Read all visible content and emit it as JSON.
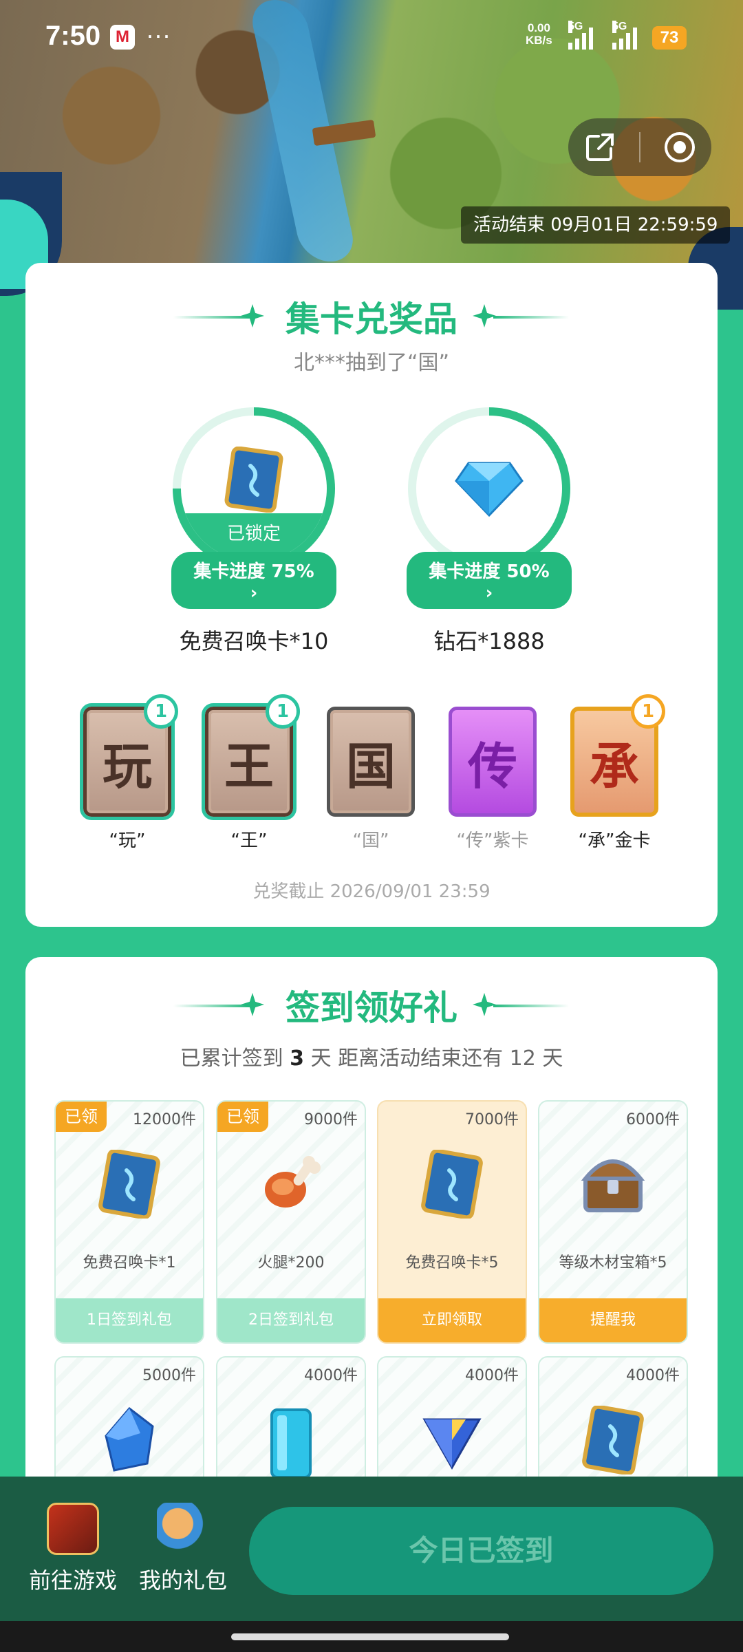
{
  "status_bar": {
    "time": "7:50",
    "carrier_badge": "M",
    "more": "···",
    "net_speed": "0.00",
    "net_unit": "KB/s",
    "signal1_label": "5G",
    "signal2_label": "5G",
    "battery": "73"
  },
  "hero": {
    "event_end": "活动结束 09月01日 22:59:59"
  },
  "card_collect": {
    "title": "集卡兑奖品",
    "subtitle": "北***抽到了“国”",
    "prizes": [
      {
        "name": "免费召唤卡*10",
        "progress": "集卡进度 75%",
        "progress_value": 0.75,
        "locked_text": "已锁定",
        "icon": "summon-card-icon"
      },
      {
        "name": "钻石*1888",
        "progress": "集卡进度 50%",
        "progress_value": 0.5,
        "icon": "diamond-icon"
      }
    ],
    "cards": [
      {
        "char": "玩",
        "label": "“玩”",
        "count": "1"
      },
      {
        "char": "王",
        "label": "“王”",
        "count": "1"
      },
      {
        "char": "国",
        "label": "“国”"
      },
      {
        "char": "传",
        "label": "“传”紫卡"
      },
      {
        "char": "承",
        "label": "“承”金卡",
        "count": "1"
      }
    ],
    "deadline": "兑奖截止 2026/09/01 23:59"
  },
  "checkin": {
    "title": "签到领好礼",
    "summary_prefix": "已累计签到 ",
    "days": "3",
    "summary_suffix": " 天  距离活动结束还有 12 天",
    "gifts": [
      {
        "qty": "12000件",
        "claimed": "已领",
        "name": "免费召唤卡*1",
        "button": "1日签到礼包",
        "icon": "summon-card-icon"
      },
      {
        "qty": "9000件",
        "claimed": "已领",
        "name": "火腿*200",
        "button": "2日签到礼包",
        "icon": "ham-icon"
      },
      {
        "qty": "7000件",
        "name": "免费召唤卡*5",
        "button": "立即领取",
        "icon": "summon-card-icon"
      },
      {
        "qty": "6000件",
        "name": "等级木材宝箱*5",
        "button": "提醒我",
        "icon": "treasure-chest-icon"
      },
      {
        "qty": "5000件",
        "icon": "blue-crystal-icon"
      },
      {
        "qty": "4000件",
        "icon": "ice-block-icon"
      },
      {
        "qty": "4000件",
        "icon": "gem-shield-icon"
      },
      {
        "qty": "4000件",
        "icon": "summon-card-icon"
      }
    ]
  },
  "bottom_bar": {
    "go_game": "前往游戏",
    "my_gifts": "我的礼包",
    "signed_today": "今日已签到"
  },
  "colors": {
    "brand_green": "#23b97e",
    "page_bg": "#2dc48d",
    "orange": "#f5a623",
    "bottom_bar": "#1b5c44"
  }
}
